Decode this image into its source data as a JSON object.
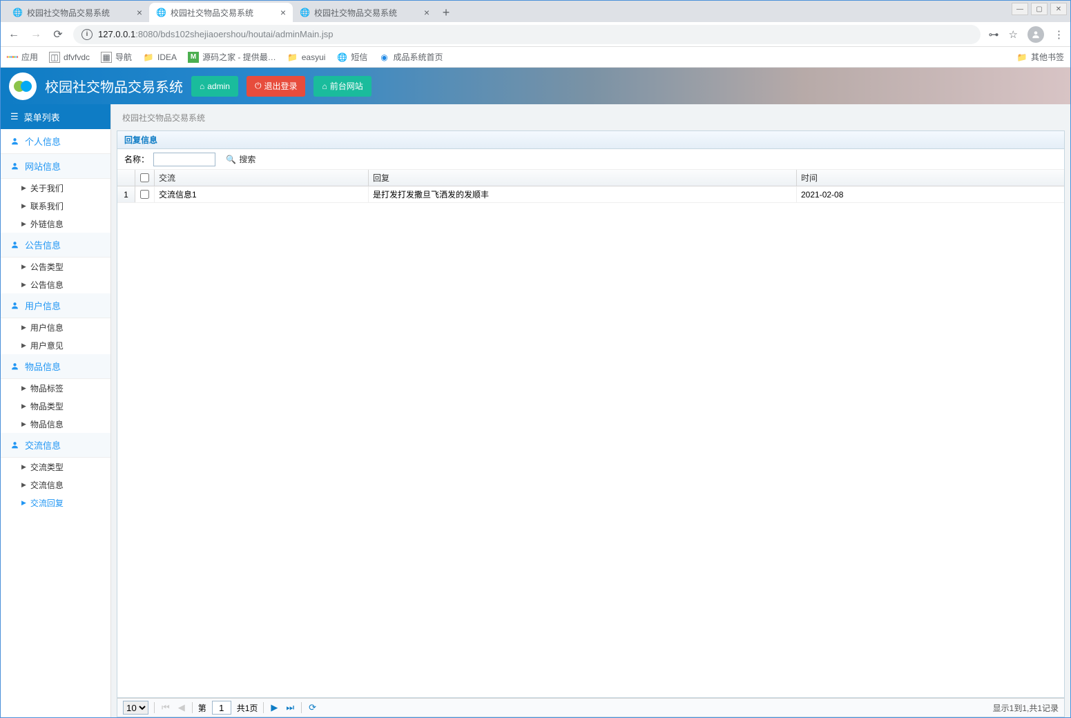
{
  "browser": {
    "tabs": [
      {
        "title": "校园社交物品交易系统",
        "active": false
      },
      {
        "title": "校园社交物品交易系统",
        "active": true
      },
      {
        "title": "校园社交物品交易系统",
        "active": false
      }
    ],
    "url_host": "127.0.0.1",
    "url_port": ":8080",
    "url_path": "/bds102shejiaoershou/houtai/adminMain.jsp",
    "bookmarks": [
      {
        "label": "应用",
        "ico": "apps"
      },
      {
        "label": "dfvfvdc",
        "ico": "img"
      },
      {
        "label": "导航",
        "ico": "apps2"
      },
      {
        "label": "IDEA",
        "ico": "folder"
      },
      {
        "label": "源码之家 - 提供最…",
        "ico": "m"
      },
      {
        "label": "easyui",
        "ico": "folder"
      },
      {
        "label": "短信",
        "ico": "globe"
      },
      {
        "label": "成品系统首页",
        "ico": "globe2"
      }
    ],
    "other_bookmarks": "其他书签"
  },
  "header": {
    "title": "校园社交物品交易系统",
    "btn_admin": "admin",
    "btn_logout": "退出登录",
    "btn_front": "前台网站"
  },
  "sidebar": {
    "header": "菜单列表",
    "groups": [
      {
        "label": "个人信息",
        "subs": []
      },
      {
        "label": "网站信息",
        "subs": [
          "关于我们",
          "联系我们",
          "外链信息"
        ]
      },
      {
        "label": "公告信息",
        "subs": [
          "公告类型",
          "公告信息"
        ]
      },
      {
        "label": "用户信息",
        "subs": [
          "用户信息",
          "用户意见"
        ]
      },
      {
        "label": "物品信息",
        "subs": [
          "物品标签",
          "物品类型",
          "物品信息"
        ]
      },
      {
        "label": "交流信息",
        "subs": [
          "交流类型",
          "交流信息",
          "交流回复"
        ]
      }
    ],
    "active_sub": "交流回复"
  },
  "main": {
    "breadcrumb": "校园社交物品交易系统",
    "panel_title": "回复信息",
    "search_label": "名称：",
    "search_value": "",
    "search_button": "搜索",
    "columns": [
      "交流",
      "回复",
      "时间"
    ],
    "rows": [
      {
        "num": "1",
        "c1": "交流信息1",
        "c2": "是打发打发撒旦飞洒发的发顺丰",
        "c3": "2021-02-08"
      }
    ],
    "pager": {
      "page_size": "10",
      "page_label_prefix": "第",
      "page_value": "1",
      "page_label_suffix": "共1页",
      "info": "显示1到1,共1记录"
    }
  }
}
